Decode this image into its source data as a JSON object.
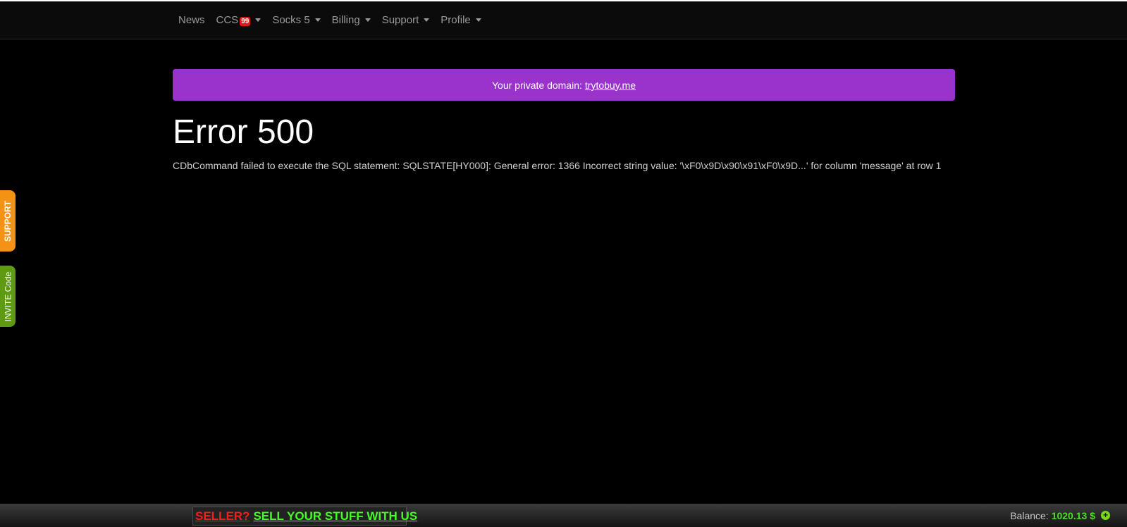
{
  "nav": {
    "items": [
      {
        "label": "News",
        "dropdown": false
      },
      {
        "label": "CCS",
        "badge": "99",
        "dropdown": true
      },
      {
        "label": "Socks 5",
        "dropdown": true
      },
      {
        "label": "Billing",
        "dropdown": true
      },
      {
        "label": "Support",
        "dropdown": true
      },
      {
        "label": "Profile",
        "dropdown": true
      }
    ]
  },
  "alert": {
    "text": "Your private domain:",
    "link": "trytobuy.me",
    "color": "#9933cc"
  },
  "error": {
    "title": "Error 500",
    "message": "CDbCommand failed to execute the SQL statement: SQLSTATE[HY000]: General error: 1366 Incorrect string value: '\\xF0\\x9D\\x90\\x91\\xF0\\x9D...' for column 'message' at row 1"
  },
  "side_tabs": {
    "support": {
      "label": "SUPPORT",
      "color": "#f39214"
    },
    "invite": {
      "label": "INVITE Code",
      "color": "#5e9a12"
    }
  },
  "footer": {
    "seller_q": "SELLER?",
    "seller_cta": "SELL YOUR STUFF WITH US",
    "balance_label": "Balance:",
    "balance_value": "1020.13 $",
    "add_icon": "plus-circle-icon"
  }
}
